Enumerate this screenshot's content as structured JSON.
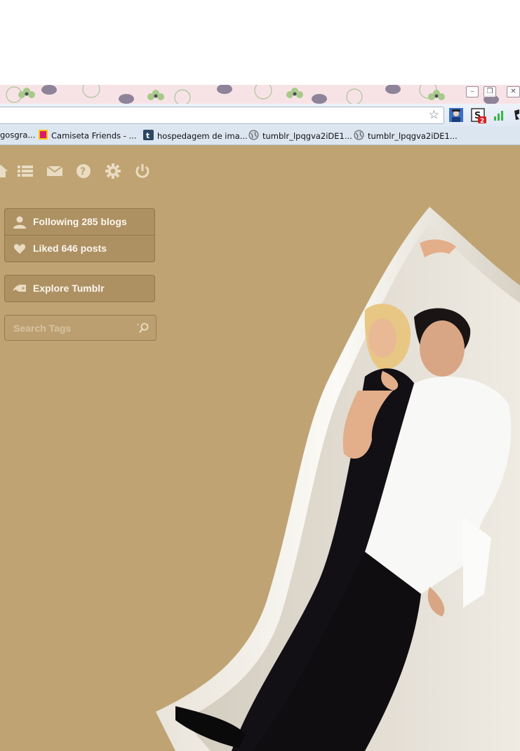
{
  "browser": {
    "window_controls": {
      "minimize_glyph": "–",
      "maximize_glyph": "❐",
      "close_glyph": "✕"
    },
    "extensions": [
      {
        "name": "avatar-extension-icon",
        "color": "#2b5fb8"
      },
      {
        "name": "s-extension-icon",
        "badge": "2"
      },
      {
        "name": "signal-bars-icon",
        "color": "#39b54a"
      }
    ],
    "bookmarks": [
      {
        "label": "gosgra...",
        "icon": "page-icon"
      },
      {
        "label": "Camiseta Friends - ...",
        "icon": "pink-favicon"
      },
      {
        "label": "hospedagem de ima...",
        "icon": "tumblr-favicon"
      },
      {
        "label": "tumblr_lpqgva2iDE1...",
        "icon": "globe-icon"
      },
      {
        "label": "tumblr_lpqgva2iDE1...",
        "icon": "globe-icon"
      }
    ]
  },
  "dashboard": {
    "nav_icons": [
      "home-icon",
      "list-icon",
      "mail-icon",
      "help-icon",
      "gear-icon",
      "power-icon"
    ],
    "following_label": "Following 285 blogs",
    "liked_label": "Liked 646 posts",
    "explore_label": "Explore Tumblr",
    "search_placeholder": "Search Tags",
    "colors": {
      "background": "#bfa373",
      "panel_text": "#fbf6ee"
    }
  }
}
